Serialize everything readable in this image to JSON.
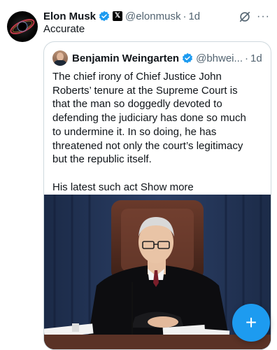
{
  "tweet": {
    "author_name": "Elon Musk",
    "handle": "@elonmusk",
    "separator": "·",
    "time": "1d",
    "text": "Accurate",
    "more_label": "···",
    "avatar_icon": "galaxy-avatar-icon",
    "verified_icon": "verified-badge-icon",
    "affiliate_label": "𝕏"
  },
  "quote": {
    "author_name": "Benjamin Weingarten",
    "handle": "@bhwei...",
    "separator": "·",
    "time": "1d",
    "body_lines": [
      "The chief irony of Chief Justice John",
      "Roberts’ tenure at the Supreme Court is",
      "that the man so doggedly devoted to",
      "defending the judiciary has done so much",
      "to undermine it. In so doing, he has",
      "threatened not only the court’s legitimacy",
      "but the republic itself."
    ],
    "teaser": "His latest such act",
    "show_more": "Show more",
    "media_description_icon": "video-thumbnail"
  },
  "fab": {
    "label": "+",
    "icon": "compose-plus-icon"
  },
  "colors": {
    "accent": "#1d9bf0",
    "secondary_text": "#536471",
    "border": "#cfd9de"
  }
}
